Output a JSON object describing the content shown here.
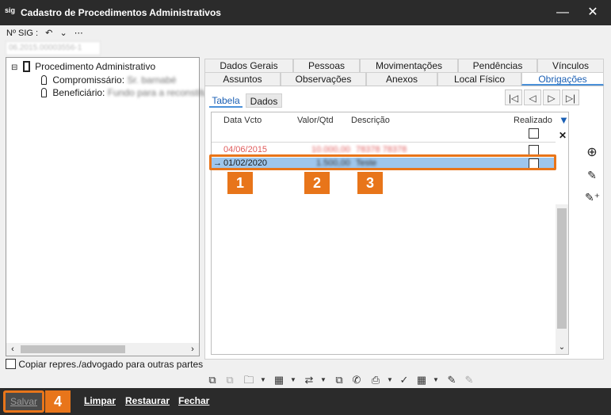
{
  "window": {
    "title": "Cadastro de Procedimentos Administrativos",
    "app_icon_text": "sig"
  },
  "sig": {
    "label": "Nº SIG :",
    "value": "06.2015.00003556-1"
  },
  "tree": {
    "root": "Procedimento Administrativo",
    "compromissario_label": "Compromissário:",
    "compromissario_value": "Sr. barnabé",
    "beneficiario_label": "Beneficiário:",
    "beneficiario_value": "Fundo para a reconstituição"
  },
  "copy_checkbox_label": "Copiar repres./advogado para outras partes",
  "tabs_row1": [
    "Dados Gerais",
    "Pessoas",
    "Movimentações",
    "Pendências",
    "Vínculos"
  ],
  "tabs_row2": [
    "Assuntos",
    "Observações",
    "Anexos",
    "Local Físico",
    "Obrigações"
  ],
  "active_tab": "Obrigações",
  "subtabs": [
    "Tabela",
    "Dados"
  ],
  "grid": {
    "columns": [
      "Data Vcto",
      "Valor/Qtd",
      "Descrição",
      "Realizado"
    ],
    "rows": [
      {
        "date": "04/06/2015",
        "valor": "10.000,00",
        "descricao": "78378 78378",
        "style": "red"
      },
      {
        "date": "01/02/2020",
        "valor": "1.500,00",
        "descricao": "Teste",
        "style": "selected"
      }
    ]
  },
  "badges": [
    "1",
    "2",
    "3",
    "4"
  ],
  "bottom": {
    "salvar": "Salvar",
    "limpar": "Limpar",
    "restaurar": "Restaurar",
    "fechar": "Fechar"
  },
  "colors": {
    "accent": "#e8751a",
    "selection": "#9ec6ec",
    "titlebar": "#2b2b2b",
    "red_row": "#e05a5a"
  }
}
